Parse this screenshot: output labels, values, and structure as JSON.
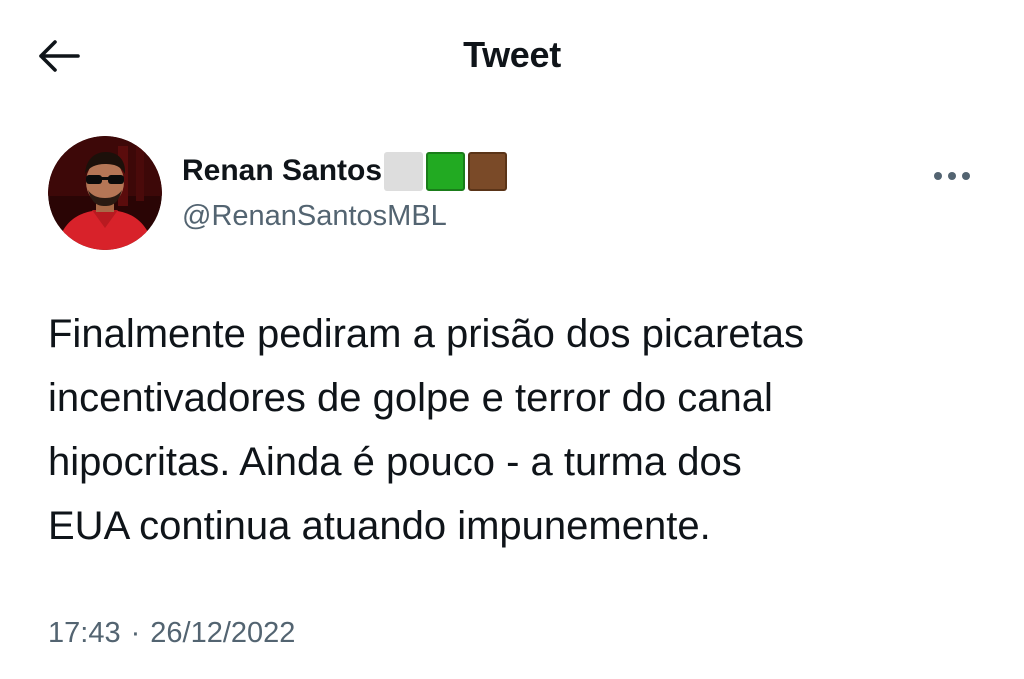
{
  "header": {
    "title": "Tweet",
    "back_icon": "arrow-left-icon"
  },
  "author": {
    "display_name": "Renan Santos",
    "handle": "@RenanSantosMBL",
    "name_squares": [
      "#dddddd",
      "#22aa22",
      "#7a4a28"
    ],
    "avatar_icon": "avatar-photo"
  },
  "tweet": {
    "text": "Finalmente pediram a prisão dos picaretas\nincentivadores de golpe e terror do canal\nhipocritas. Ainda é pouco - a turma dos\nEUA continua atuando impunemente.",
    "time": "17:43",
    "separator": "·",
    "date": "26/12/2022",
    "more_icon": "more-horizontal-icon"
  },
  "colors": {
    "text_primary": "#0f1419",
    "text_secondary": "#536471",
    "background": "#ffffff"
  }
}
